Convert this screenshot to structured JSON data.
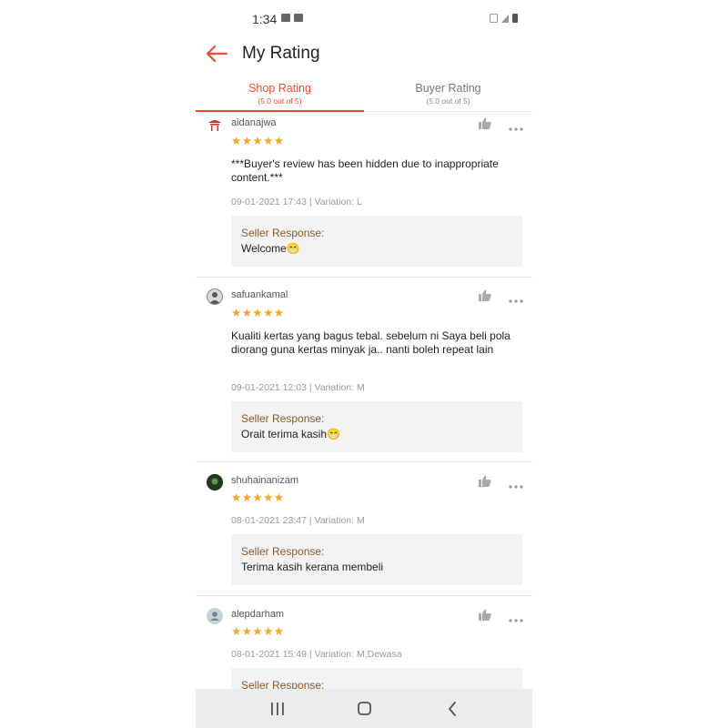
{
  "status_bar": {
    "time": "1:34"
  },
  "header": {
    "title": "My Rating",
    "back_icon": "arrow-left-icon"
  },
  "colors": {
    "accent": "#ee4d2d",
    "star": "#f5a623",
    "response_label": "#8a5a2a"
  },
  "tabs": [
    {
      "label": "Shop Rating",
      "sub": "(5.0 out of 5)",
      "active": true
    },
    {
      "label": "Buyer Rating",
      "sub": "(5.0 out of 5)",
      "active": false
    }
  ],
  "reviews": [
    {
      "username": "aidanajwa",
      "stars": "★★★★★",
      "rating": 5,
      "text": "***Buyer's review has been hidden due to inappropriate content.***",
      "meta": "09-01-2021 17:43 | Variation: L",
      "response_label": "Seller Response:",
      "response_text": "Welcome😁"
    },
    {
      "username": "safuankamal",
      "stars": "★★★★★",
      "rating": 5,
      "text": "Kualiti kertas yang bagus tebal. sebelum ni Saya beli pola diorang guna kertas minyak ja.. nanti boleh repeat lain",
      "meta": "09-01-2021 12:03 | Variation: M",
      "response_label": "Seller Response:",
      "response_text": "Orait terima kasih😁"
    },
    {
      "username": "shuhainanizam",
      "stars": "★★★★★",
      "rating": 5,
      "text": "",
      "meta": "08-01-2021 23:47 | Variation: M",
      "response_label": "Seller Response:",
      "response_text": "Terima kasih kerana membeli"
    },
    {
      "username": "alepdarham",
      "stars": "★★★★★",
      "rating": 5,
      "text": "",
      "meta": "08-01-2021 15:49 | Variation: M,Dewasa",
      "response_label": "Seller Response:",
      "response_text": ""
    }
  ],
  "icons": {
    "like": "thumbs-up-icon",
    "more": "more-horizontal-icon",
    "nav_recents": "recents-icon",
    "nav_home": "home-icon",
    "nav_back": "back-chevron-icon"
  }
}
